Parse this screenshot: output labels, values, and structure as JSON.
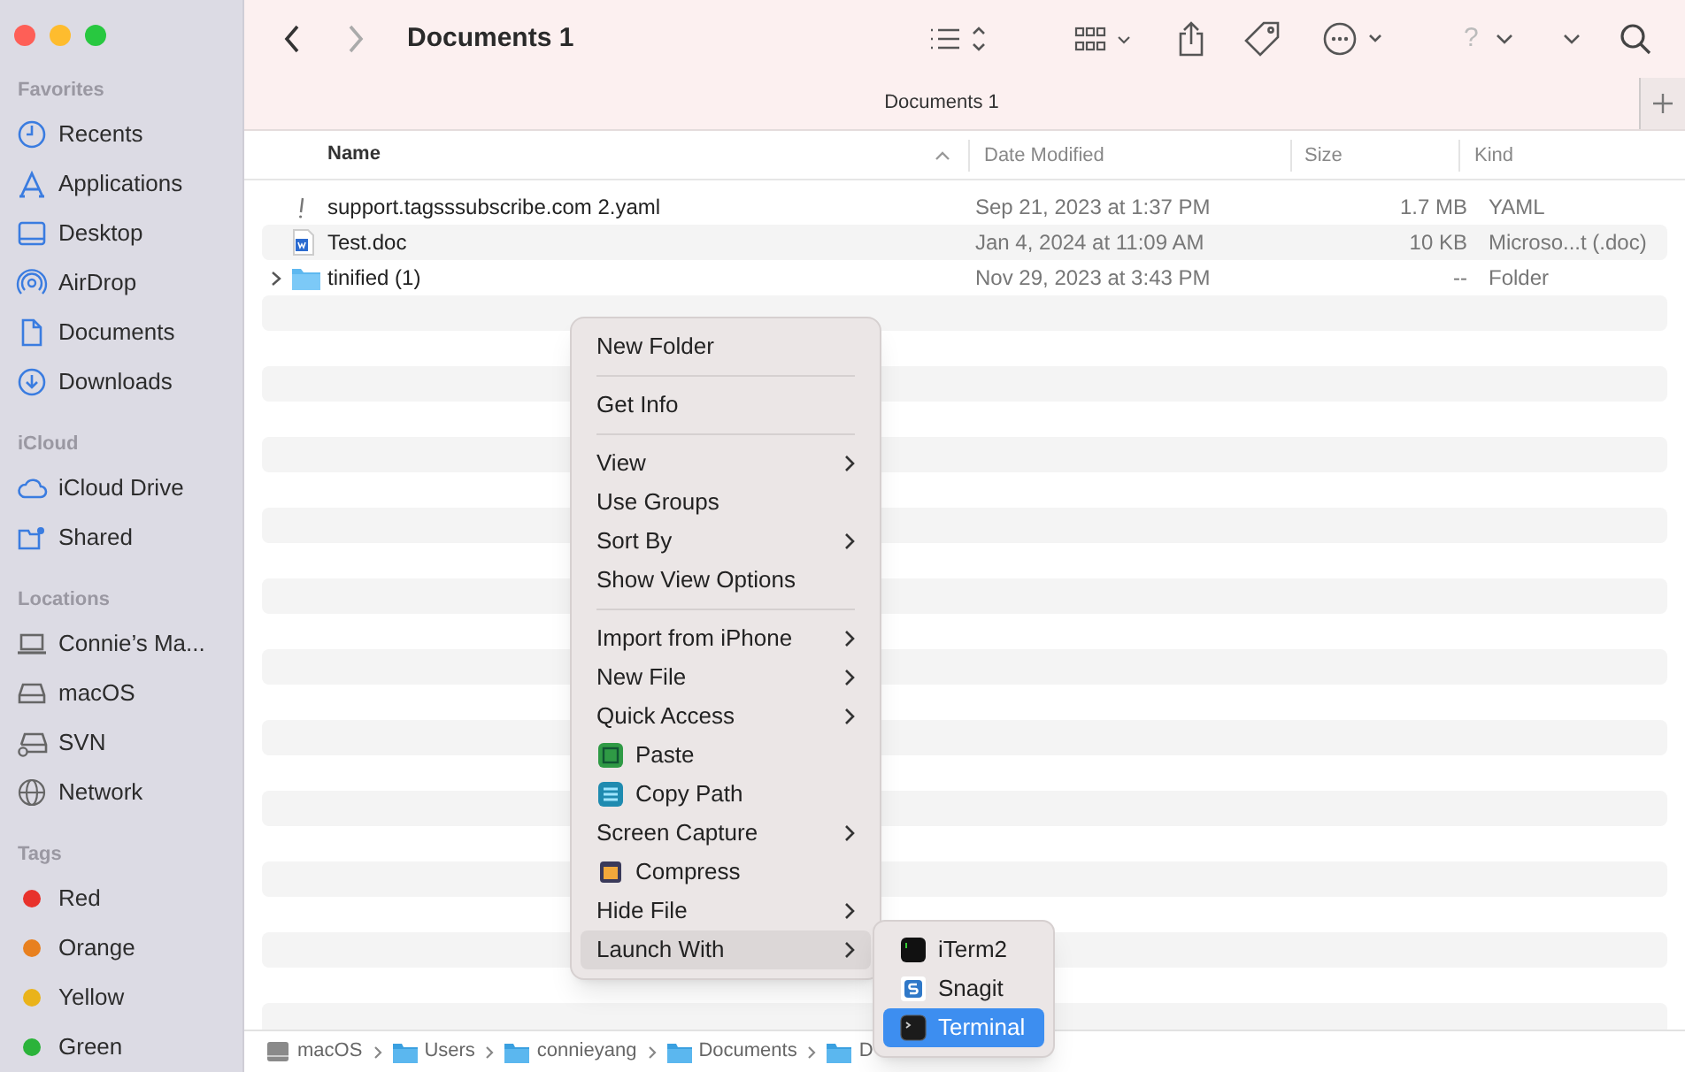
{
  "window": {
    "title": "Documents 1"
  },
  "sidebar": {
    "sections": [
      {
        "heading": "Favorites",
        "items": [
          {
            "label": "Recents",
            "kind": "clock"
          },
          {
            "label": "Applications",
            "kind": "apps"
          },
          {
            "label": "Desktop",
            "kind": "desktop"
          },
          {
            "label": "AirDrop",
            "kind": "airdrop"
          },
          {
            "label": "Documents",
            "kind": "doc"
          },
          {
            "label": "Downloads",
            "kind": "download"
          }
        ]
      },
      {
        "heading": "iCloud",
        "items": [
          {
            "label": "iCloud Drive",
            "kind": "cloud"
          },
          {
            "label": "Shared",
            "kind": "shared"
          }
        ]
      },
      {
        "heading": "Locations",
        "items": [
          {
            "label": "Connie’s Ma...",
            "kind": "laptop"
          },
          {
            "label": "macOS",
            "kind": "disk"
          },
          {
            "label": "SVN",
            "kind": "netdisk"
          },
          {
            "label": "Network",
            "kind": "globe"
          }
        ]
      },
      {
        "heading": "Tags",
        "items": [
          {
            "label": "Red",
            "kind": "tag",
            "color": "#e8322c"
          },
          {
            "label": "Orange",
            "kind": "tag",
            "color": "#e8801f"
          },
          {
            "label": "Yellow",
            "kind": "tag",
            "color": "#eab31a"
          },
          {
            "label": "Green",
            "kind": "tag",
            "color": "#2bb33a"
          }
        ]
      }
    ]
  },
  "toolbar": {
    "help_glyph": "?"
  },
  "tabs": [
    {
      "label": "Documents 1",
      "selected": true
    }
  ],
  "table": {
    "columns": [
      "Name",
      "Date Modified",
      "Size",
      "Kind"
    ],
    "rows": [
      {
        "name": "support.tagsssubscribe.com 2.yaml",
        "date_modified": "Sep 21, 2023 at 1:37 PM",
        "size": "1.7 MB",
        "file_type": "YAML",
        "kind": "yaml",
        "expandable": false
      },
      {
        "name": "Test.doc",
        "date_modified": "Jan 4, 2024 at 11:09 AM",
        "size": "10 KB",
        "file_type": "Microso...t (.doc)",
        "kind": "word",
        "expandable": false
      },
      {
        "name": "tinified (1)",
        "date_modified": "Nov 29, 2023 at 3:43 PM",
        "size": "--",
        "file_type": "Folder",
        "kind": "folder",
        "expandable": true
      }
    ]
  },
  "context_menu": {
    "groups": [
      [
        {
          "label": "New Folder",
          "kind": "plain",
          "submenu": false,
          "selected": false
        }
      ],
      [
        {
          "label": "Get Info",
          "kind": "plain",
          "submenu": false,
          "selected": false
        }
      ],
      [
        {
          "label": "View",
          "kind": "plain",
          "submenu": true,
          "selected": false
        },
        {
          "label": "Use Groups",
          "kind": "plain",
          "submenu": false,
          "selected": false
        },
        {
          "label": "Sort By",
          "kind": "plain",
          "submenu": true,
          "selected": false
        },
        {
          "label": "Show View Options",
          "kind": "plain",
          "submenu": false,
          "selected": false
        }
      ],
      [
        {
          "label": "Import from iPhone",
          "kind": "plain",
          "submenu": true,
          "selected": false
        },
        {
          "label": "New File",
          "kind": "plain",
          "submenu": true,
          "selected": false
        },
        {
          "label": "Quick Access",
          "kind": "plain",
          "submenu": true,
          "selected": false
        },
        {
          "label": "Paste",
          "kind": "paste",
          "submenu": false,
          "selected": false
        },
        {
          "label": "Copy Path",
          "kind": "copypath",
          "submenu": false,
          "selected": false
        },
        {
          "label": "Screen Capture",
          "kind": "plain",
          "submenu": true,
          "selected": false
        },
        {
          "label": "Compress",
          "kind": "compress",
          "submenu": false,
          "selected": false
        },
        {
          "label": "Hide File",
          "kind": "plain",
          "submenu": true,
          "selected": false
        },
        {
          "label": "Launch With",
          "kind": "plain",
          "submenu": true,
          "selected": true
        }
      ]
    ]
  },
  "submenu": {
    "items": [
      {
        "label": "iTerm2",
        "kind": "iterm",
        "selected": false
      },
      {
        "label": "Snagit",
        "kind": "snagit",
        "selected": false
      },
      {
        "label": "Terminal",
        "kind": "terminal",
        "selected": true
      }
    ]
  },
  "path_bar": [
    {
      "label": "macOS",
      "kind": "disk"
    },
    {
      "label": "Users",
      "kind": "folder"
    },
    {
      "label": "connieyang",
      "kind": "folder"
    },
    {
      "label": "Documents",
      "kind": "folder"
    },
    {
      "label": "D",
      "kind": "folder"
    }
  ]
}
